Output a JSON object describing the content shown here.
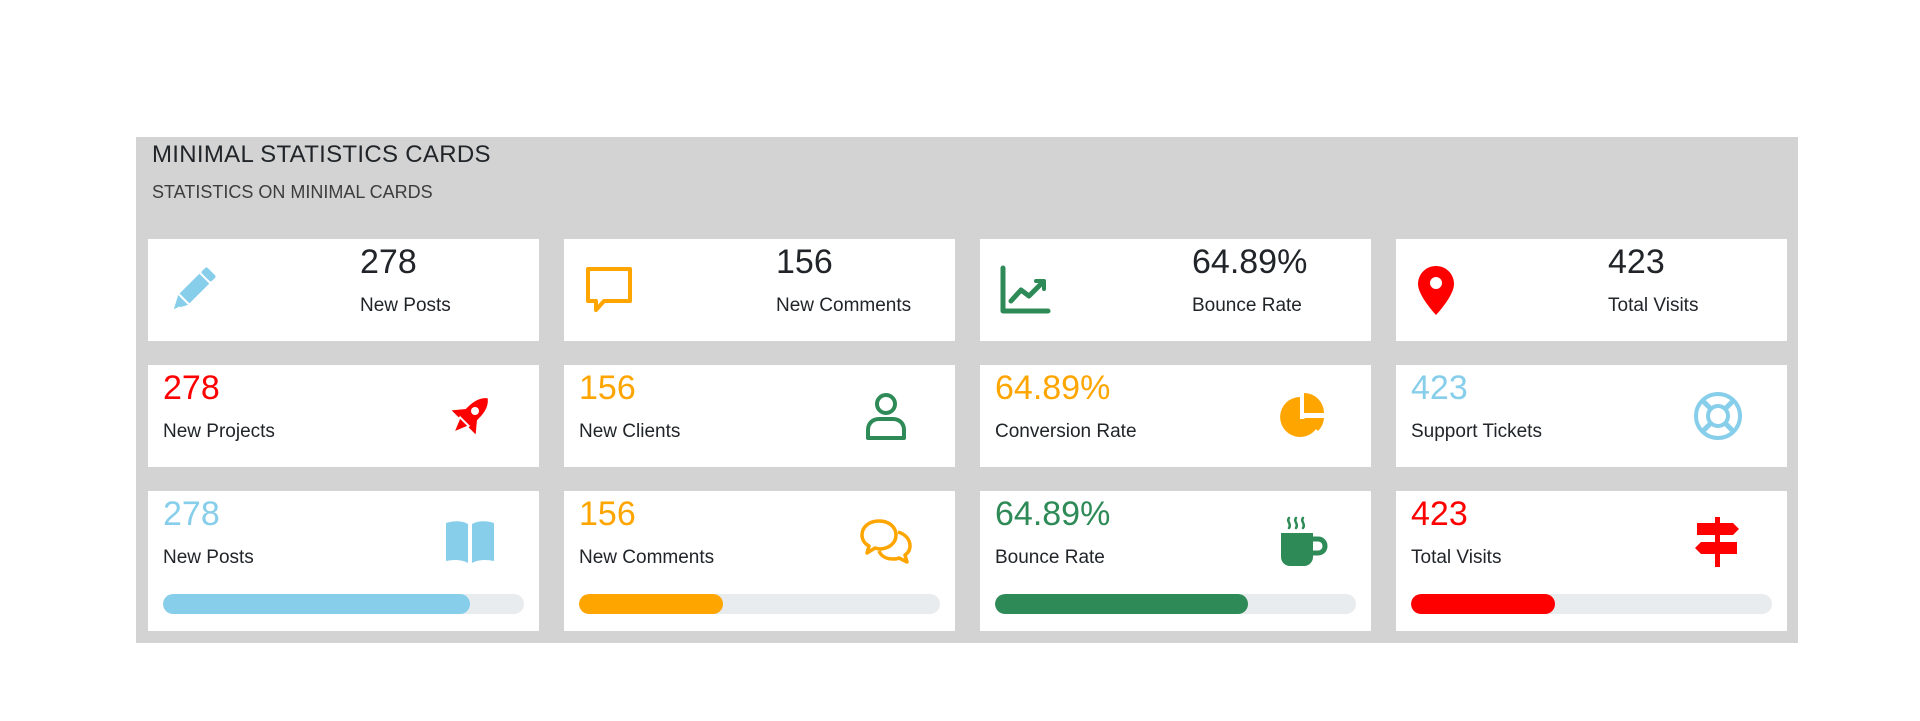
{
  "panel": {
    "title": "MINIMAL STATISTICS CARDS",
    "subtitle": "STATISTICS ON MINIMAL CARDS"
  },
  "colors": {
    "blue": "#87ceeb",
    "orange": "#ffa500",
    "green": "#2e8b57",
    "red": "#ff0000",
    "dark": "#212529",
    "track": "#e9ecef",
    "panel_bg": "#d3d3d3"
  },
  "row1": [
    {
      "value": "278",
      "label": "New Posts",
      "icon": "pencil-icon",
      "color": "#87ceeb"
    },
    {
      "value": "156",
      "label": "New Comments",
      "icon": "speech-bubble-icon",
      "color": "#ffa500"
    },
    {
      "value": "64.89%",
      "label": "Bounce Rate",
      "icon": "line-chart-icon",
      "color": "#2e8b57"
    },
    {
      "value": "423",
      "label": "Total Visits",
      "icon": "map-pin-icon",
      "color": "#ff0000"
    }
  ],
  "row2": [
    {
      "value": "278",
      "label": "New Projects",
      "icon": "rocket-icon",
      "color": "#ff0000",
      "value_color": "#ff0000"
    },
    {
      "value": "156",
      "label": "New Clients",
      "icon": "user-icon",
      "color": "#2e8b57",
      "value_color": "#ffa500"
    },
    {
      "value": "64.89%",
      "label": "Conversion Rate",
      "icon": "pie-chart-icon",
      "color": "#ffa500",
      "value_color": "#ffa500"
    },
    {
      "value": "423",
      "label": "Support Tickets",
      "icon": "life-ring-icon",
      "color": "#87ceeb",
      "value_color": "#87ceeb"
    }
  ],
  "row3": [
    {
      "value": "278",
      "label": "New Posts",
      "icon": "open-book-icon",
      "color": "#87ceeb",
      "value_color": "#87ceeb",
      "progress": 0.85
    },
    {
      "value": "156",
      "label": "New Comments",
      "icon": "chat-bubbles-icon",
      "color": "#ffa500",
      "value_color": "#ffa500",
      "progress": 0.4
    },
    {
      "value": "64.89%",
      "label": "Bounce Rate",
      "icon": "coffee-cup-icon",
      "color": "#2e8b57",
      "value_color": "#2e8b57",
      "progress": 0.7
    },
    {
      "value": "423",
      "label": "Total Visits",
      "icon": "signpost-icon",
      "color": "#ff0000",
      "value_color": "#ff0000",
      "progress": 0.4
    }
  ]
}
